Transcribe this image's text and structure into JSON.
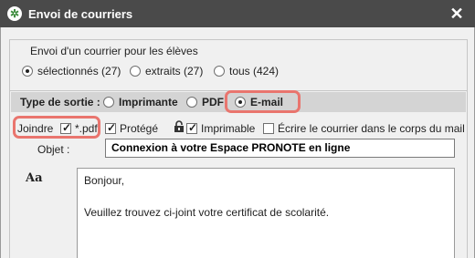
{
  "window": {
    "title": "Envoi de courriers",
    "close_glyph": "✕"
  },
  "recipients": {
    "legend": "Envoi d'un courrier pour les élèves",
    "options": [
      {
        "label": "sélectionnés (27)",
        "checked": true
      },
      {
        "label": "extraits (27)",
        "checked": false
      },
      {
        "label": "tous (424)",
        "checked": false
      }
    ]
  },
  "output": {
    "label": "Type de sortie :",
    "options": [
      {
        "label": "Imprimante",
        "checked": false
      },
      {
        "label": "PDF",
        "checked": false
      },
      {
        "label": "E-mail",
        "checked": true
      }
    ]
  },
  "attach": {
    "label": "Joindre",
    "options": [
      {
        "label": "*.pdf",
        "checked": true
      },
      {
        "label": "Protégé",
        "checked": true
      },
      {
        "label": "Imprimable",
        "checked": true
      },
      {
        "label": "Écrire le courrier dans le corps du mail",
        "checked": false
      }
    ]
  },
  "subject": {
    "label": "Objet :",
    "value": "Connexion à votre Espace PRONOTE en ligne"
  },
  "editor": {
    "font_icon": "Aa",
    "lines": [
      "Bonjour,",
      "Veuillez trouvez ci-joint votre certificat de scolarité."
    ]
  },
  "colors": {
    "titlebar": "#4a4a4a",
    "highlight": "#e9756e",
    "sortie_bar": "#d4d4d4"
  }
}
